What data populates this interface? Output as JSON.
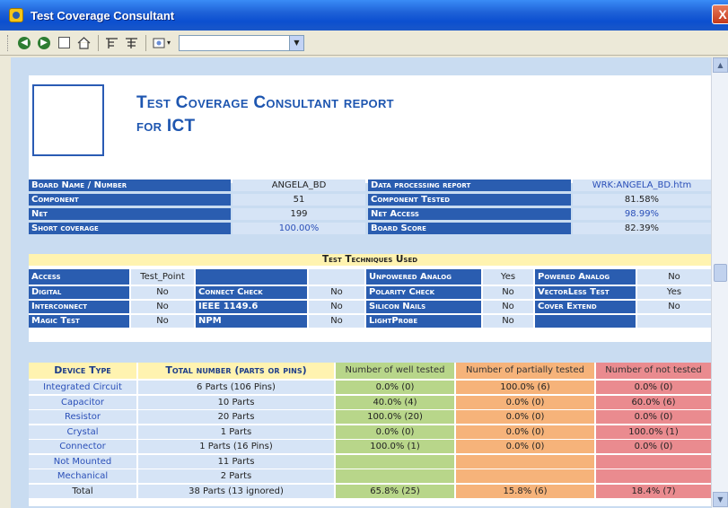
{
  "window": {
    "title": "Test Coverage Consultant",
    "close_glyph": "X"
  },
  "toolbar": {
    "combo_value": ""
  },
  "report": {
    "title_line1": "Test Coverage Consultant report",
    "title_line2": "for ICT"
  },
  "summary": {
    "left": [
      {
        "label": "Board Name / Number",
        "value": "ANGELA_BD"
      },
      {
        "label": "Component",
        "value": "51"
      },
      {
        "label": "Net",
        "value": "199"
      },
      {
        "label": "Short coverage",
        "value": "100.00%"
      }
    ],
    "right": [
      {
        "label": "Data processing report",
        "value": "WRK:ANGELA_BD.htm"
      },
      {
        "label": "Component Tested",
        "value": "81.58%"
      },
      {
        "label": "Net Access",
        "value": "98.99%"
      },
      {
        "label": "Board Score",
        "value": "82.39%"
      }
    ]
  },
  "techniques": {
    "title": "Test Techniques Used",
    "rows": [
      [
        {
          "label": "Access",
          "value": "Test_Point"
        },
        {
          "label": "",
          "value": ""
        },
        {
          "label": "Unpowered Analog",
          "value": "Yes"
        },
        {
          "label": "Powered Analog",
          "value": "No"
        }
      ],
      [
        {
          "label": "Digital",
          "value": "No"
        },
        {
          "label": "Connect Check",
          "value": "No"
        },
        {
          "label": "Polarity Check",
          "value": "No"
        },
        {
          "label": "VectorLess Test",
          "value": "Yes"
        }
      ],
      [
        {
          "label": "Interconnect",
          "value": "No"
        },
        {
          "label": "IEEE 1149.6",
          "value": "No"
        },
        {
          "label": "Silicon Nails",
          "value": "No"
        },
        {
          "label": "Cover Extend",
          "value": "No"
        }
      ],
      [
        {
          "label": "Magic Test",
          "value": "No"
        },
        {
          "label": "NPM",
          "value": "No"
        },
        {
          "label": "LightProbe",
          "value": "No"
        },
        {
          "label": "",
          "value": ""
        }
      ]
    ]
  },
  "devices": {
    "headers": [
      "Device Type",
      "Total number (parts or pins)",
      "Number of well tested",
      "Number of partially tested",
      "Number of not tested"
    ],
    "rows": [
      [
        "Integrated Circuit",
        "6 Parts (106 Pins)",
        "0.0% (0)",
        "100.0% (6)",
        "0.0% (0)"
      ],
      [
        "Capacitor",
        "10 Parts",
        "40.0% (4)",
        "0.0% (0)",
        "60.0% (6)"
      ],
      [
        "Resistor",
        "20 Parts",
        "100.0% (20)",
        "0.0% (0)",
        "0.0% (0)"
      ],
      [
        "Crystal",
        "1 Parts",
        "0.0% (0)",
        "0.0% (0)",
        "100.0% (1)"
      ],
      [
        "Connector",
        "1 Parts (16 Pins)",
        "100.0% (1)",
        "0.0% (0)",
        "0.0% (0)"
      ],
      [
        "Not Mounted",
        "11 Parts",
        "",
        "",
        ""
      ],
      [
        "Mechanical",
        "2 Parts",
        "",
        "",
        ""
      ],
      [
        "Total",
        "38 Parts (13 ignored)",
        "65.8% (25)",
        "15.8% (6)",
        "18.4% (7)"
      ]
    ]
  }
}
